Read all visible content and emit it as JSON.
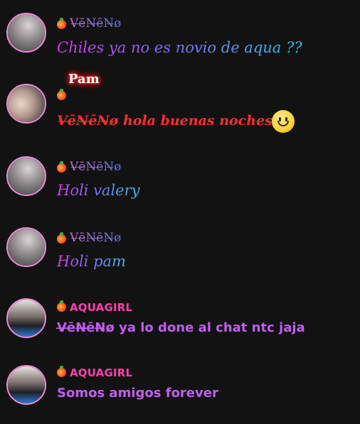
{
  "messages": [
    {
      "username": "V̶ē̶N̶ē̶N̶ø",
      "text": "Chiles ya no es novio de aqua ??"
    },
    {
      "title": "Pam",
      "text": "V̶ē̶N̶ē̶N̶ø hola buenas noches!!"
    },
    {
      "username": "V̶ē̶N̶ē̶N̶ø",
      "text": "Holi valery"
    },
    {
      "username": "V̶ē̶N̶ē̶N̶ø",
      "text": "Holi pam"
    },
    {
      "username": "AQUAGIRL",
      "text": "V̶ē̶N̶ē̶N̶ø ya lo done al chat ntc jaja"
    },
    {
      "username": "AQUAGIRL",
      "text": "Somos amigos forever"
    }
  ],
  "icons": {
    "badge": "fire-strawberry-badge-icon",
    "emoji": "smiley-face-icon"
  },
  "colors": {
    "background": "#121212",
    "avatar_ring": "#f08ad8",
    "red_text": "#ff2e2e",
    "purple_text": "#c25cf0",
    "aquagirl_name": "#ff3fb0"
  }
}
